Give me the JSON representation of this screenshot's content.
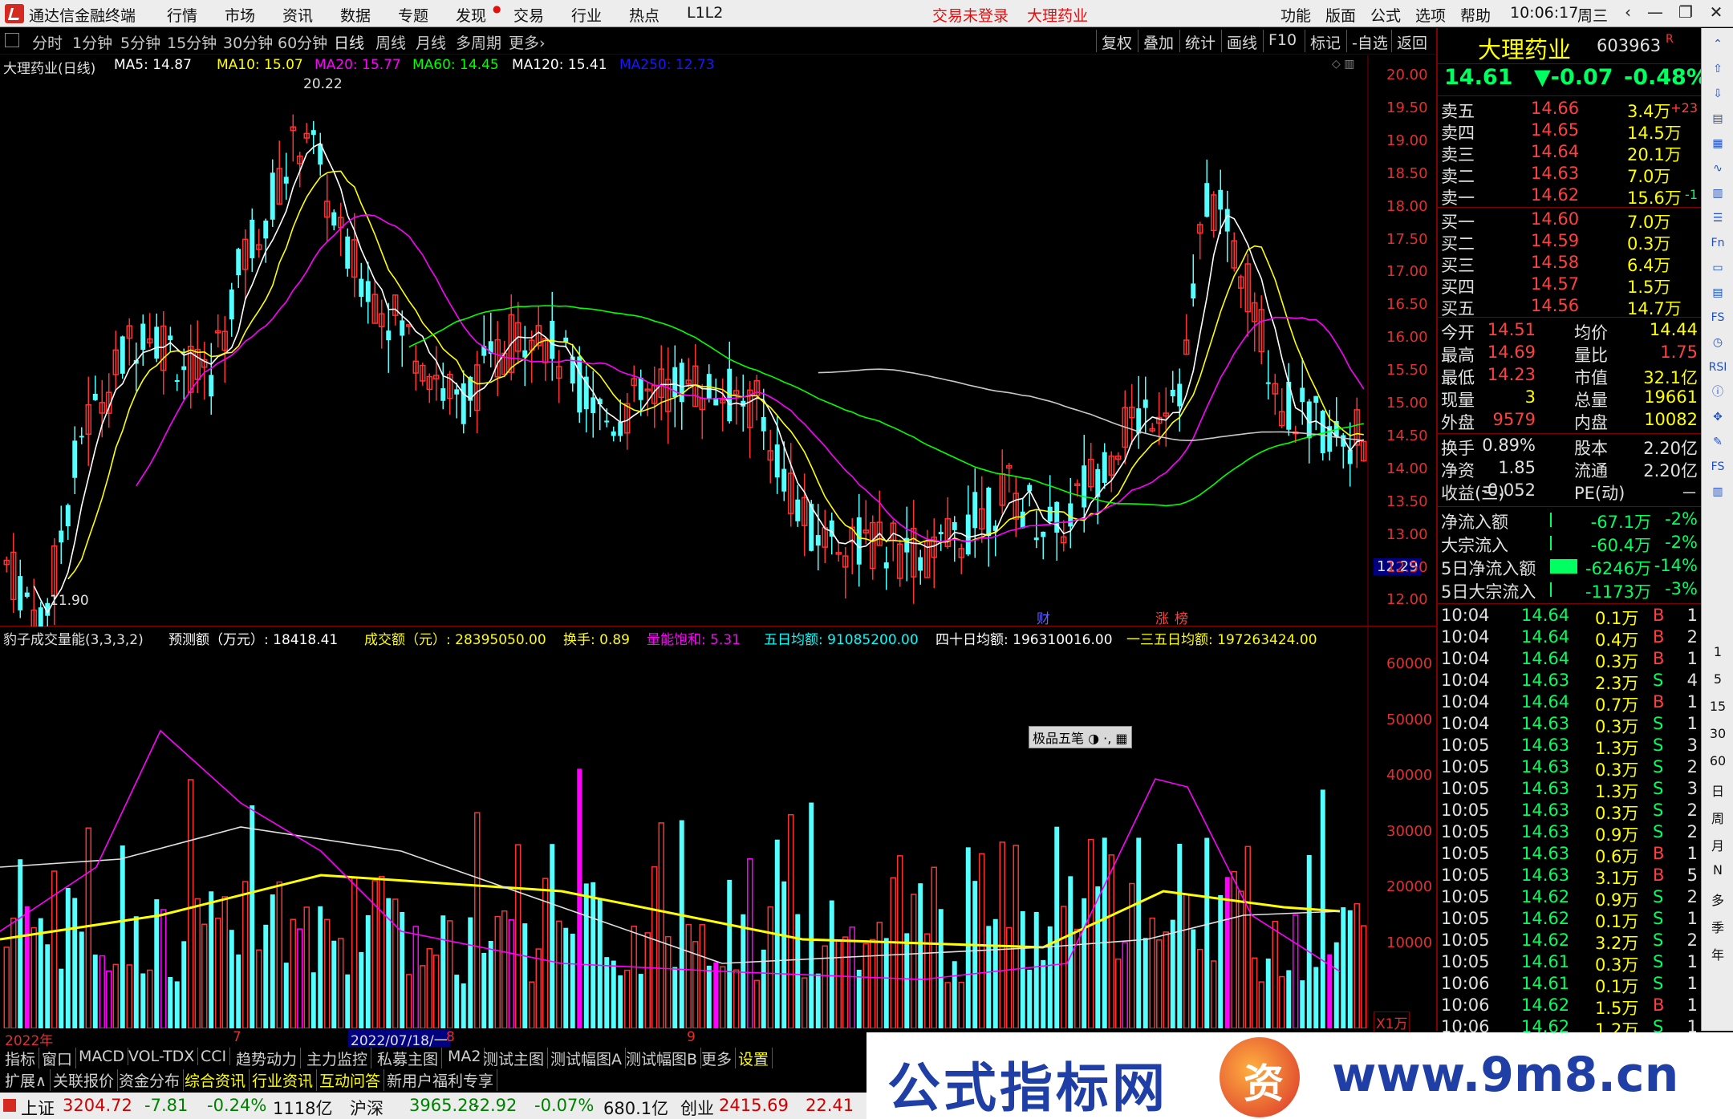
{
  "menubar": {
    "app_title": "通达信金融终端",
    "items": [
      "行情",
      "市场",
      "资讯",
      "数据",
      "专题",
      "发现",
      "交易",
      "行业",
      "热点",
      "L1L2"
    ],
    "login_status": "交易未登录",
    "stock_name": "大理药业",
    "right_items": [
      "功能",
      "版面",
      "公式",
      "选项",
      "帮助"
    ],
    "time": "10:06:17",
    "weekday": "周三",
    "window_buttons": [
      "‹",
      "—",
      "❐",
      "✕"
    ]
  },
  "toolbar": {
    "period_tabs": [
      "分时",
      "1分钟",
      "5分钟",
      "15分钟",
      "30分钟",
      "60分钟",
      "日线",
      "周线",
      "月线",
      "多周期",
      "更多›"
    ],
    "active_tab": "日线",
    "right_buttons": [
      "复权",
      "叠加",
      "统计",
      "画线",
      "F10",
      "标记",
      "-自选",
      "返回"
    ]
  },
  "main_chart": {
    "title": "大理药业(日线)",
    "ma_labels": [
      {
        "text": "MA5: 14.87",
        "color": "#ffffff"
      },
      {
        "text": "MA10: 15.07",
        "color": "#ffff00"
      },
      {
        "text": "MA20: 15.77",
        "color": "#ff00ff"
      },
      {
        "text": "MA60: 14.45",
        "color": "#00ff00"
      },
      {
        "text": "MA120: 15.41",
        "color": "#ffffff"
      },
      {
        "text": "MA250: 12.73",
        "color": "#0000ff"
      }
    ],
    "high_marker": "20.22",
    "low_marker": "11.90",
    "current_price_tag": "12.29",
    "price_axis": [
      "20.00",
      "19.50",
      "19.00",
      "18.50",
      "18.00",
      "17.50",
      "17.00",
      "16.50",
      "16.00",
      "15.50",
      "15.00",
      "14.50",
      "14.00",
      "13.50",
      "13.00",
      "12.50",
      "12.00"
    ],
    "event_markers": [
      "财",
      "涨",
      "榜"
    ]
  },
  "volume_chart": {
    "title": "豹子成交量能(3,3,3,2)",
    "labels": [
      {
        "text": "预测额（万元）: 18418.41",
        "color": "#ffffff"
      },
      {
        "text": "成交额（元）: 28395050.00",
        "color": "#ffff00"
      },
      {
        "text": "换手: 0.89",
        "color": "#ffff00"
      },
      {
        "text": "量能饱和: 5.31",
        "color": "#ff00ff"
      },
      {
        "text": "五日均额: 91085200.00",
        "color": "#00ffff"
      },
      {
        "text": "四十日均额: 196310016.00",
        "color": "#ffffff"
      },
      {
        "text": "一三五日均额: 197263424.00",
        "color": "#ffff00"
      }
    ],
    "axis": [
      "60000",
      "50000",
      "40000",
      "30000",
      "20000",
      "10000"
    ],
    "unit": "X1万",
    "ime_bar": "极品五笔"
  },
  "date_axis": {
    "labels": [
      "2022年",
      "7",
      "2022/07/18/一",
      "8",
      "9"
    ]
  },
  "right_panel": {
    "stock_name": "大理药业",
    "stock_code": "603963",
    "code_flag": "R",
    "price": "14.61",
    "change": "▼-0.07",
    "change_pct": "-0.48%",
    "asks": [
      {
        "label": "卖五",
        "price": "14.66",
        "vol": "3.4万",
        "extra": "+23"
      },
      {
        "label": "卖四",
        "price": "14.65",
        "vol": "14.5万",
        "extra": ""
      },
      {
        "label": "卖三",
        "price": "14.64",
        "vol": "20.1万",
        "extra": ""
      },
      {
        "label": "卖二",
        "price": "14.63",
        "vol": "7.0万",
        "extra": ""
      },
      {
        "label": "卖一",
        "price": "14.62",
        "vol": "15.6万",
        "extra": "-1"
      }
    ],
    "bids": [
      {
        "label": "买一",
        "price": "14.60",
        "vol": "7.0万"
      },
      {
        "label": "买二",
        "price": "14.59",
        "vol": "0.3万"
      },
      {
        "label": "买三",
        "price": "14.58",
        "vol": "6.4万"
      },
      {
        "label": "买四",
        "price": "14.57",
        "vol": "1.5万"
      },
      {
        "label": "买五",
        "price": "14.56",
        "vol": "14.7万"
      }
    ],
    "stats": [
      {
        "l1": "今开",
        "v1": "14.51",
        "l2": "均价",
        "v2": "14.44"
      },
      {
        "l1": "最高",
        "v1": "14.69",
        "l2": "量比",
        "v2": "1.75"
      },
      {
        "l1": "最低",
        "v1": "14.23",
        "l2": "市值",
        "v2": "32.1亿"
      },
      {
        "l1": "现量",
        "v1": "3",
        "l2": "总量",
        "v2": "19661"
      },
      {
        "l1": "外盘",
        "v1": "9579",
        "l2": "内盘",
        "v2": "10082"
      }
    ],
    "stats2": [
      {
        "l1": "换手",
        "v1": "0.89%",
        "l2": "股本",
        "v2": "2.20亿"
      },
      {
        "l1": "净资",
        "v1": "1.85",
        "l2": "流通",
        "v2": "2.20亿"
      },
      {
        "l1": "收益(三)",
        "v1": "-0.052",
        "l2": "PE(动)",
        "v2": "－"
      }
    ],
    "flows": [
      {
        "label": "净流入额",
        "value": "-67.1万",
        "pct": "-2%"
      },
      {
        "label": "大宗流入",
        "value": "-60.4万",
        "pct": "-2%"
      },
      {
        "label": "5日净流入额",
        "value": "-6246万",
        "pct": "-14%"
      },
      {
        "label": "5日大宗流入",
        "value": "-1173万",
        "pct": "-3%"
      }
    ],
    "ticks": [
      {
        "t": "10:04",
        "p": "14.64",
        "v": "0.1万",
        "s": "B",
        "n": "1"
      },
      {
        "t": "10:04",
        "p": "14.64",
        "v": "0.4万",
        "s": "B",
        "n": "2"
      },
      {
        "t": "10:04",
        "p": "14.64",
        "v": "0.3万",
        "s": "B",
        "n": "1"
      },
      {
        "t": "10:04",
        "p": "14.63",
        "v": "2.3万",
        "s": "S",
        "n": "4"
      },
      {
        "t": "10:04",
        "p": "14.64",
        "v": "0.7万",
        "s": "B",
        "n": "1"
      },
      {
        "t": "10:04",
        "p": "14.63",
        "v": "0.3万",
        "s": "S",
        "n": "1"
      },
      {
        "t": "10:05",
        "p": "14.63",
        "v": "1.3万",
        "s": "S",
        "n": "3"
      },
      {
        "t": "10:05",
        "p": "14.63",
        "v": "0.3万",
        "s": "S",
        "n": "2"
      },
      {
        "t": "10:05",
        "p": "14.63",
        "v": "1.3万",
        "s": "S",
        "n": "3"
      },
      {
        "t": "10:05",
        "p": "14.63",
        "v": "0.3万",
        "s": "S",
        "n": "2"
      },
      {
        "t": "10:05",
        "p": "14.63",
        "v": "0.9万",
        "s": "S",
        "n": "2"
      },
      {
        "t": "10:05",
        "p": "14.63",
        "v": "0.6万",
        "s": "B",
        "n": "1"
      },
      {
        "t": "10:05",
        "p": "14.63",
        "v": "3.1万",
        "s": "B",
        "n": "5"
      },
      {
        "t": "10:05",
        "p": "14.62",
        "v": "0.9万",
        "s": "S",
        "n": "2"
      },
      {
        "t": "10:05",
        "p": "14.62",
        "v": "0.1万",
        "s": "S",
        "n": "1"
      },
      {
        "t": "10:05",
        "p": "14.62",
        "v": "3.2万",
        "s": "S",
        "n": "2"
      },
      {
        "t": "10:05",
        "p": "14.61",
        "v": "0.3万",
        "s": "S",
        "n": "1"
      },
      {
        "t": "10:06",
        "p": "14.61",
        "v": "0.1万",
        "s": "S",
        "n": "1"
      },
      {
        "t": "10:06",
        "p": "14.62",
        "v": "1.5万",
        "s": "B",
        "n": "1"
      },
      {
        "t": "10:06",
        "p": "14.62",
        "v": "1.2万",
        "s": "S",
        "n": "1"
      }
    ]
  },
  "sidebar": {
    "icons": [
      "up-arrow-icon",
      "up-arrow-icon",
      "down-arrow-icon",
      "chart-icon",
      "grid-icon",
      "line-chart-icon",
      "bar-icon",
      "list-icon",
      "f10-icon",
      "doc-icon",
      "table-icon",
      "fs-icon",
      "clock-icon",
      "rsi-icon",
      "info-icon",
      "move-icon",
      "pen-icon",
      "fs2-icon",
      "book-icon"
    ],
    "periods": [
      "1",
      "5",
      "15",
      "30",
      "60",
      "日",
      "周",
      "月",
      "N",
      "多",
      "季",
      "年"
    ]
  },
  "bottom_tabs_1": [
    "指标",
    "窗口",
    "MACD",
    "VOL-TDX",
    "CCI",
    "趋势动力",
    "主力监控",
    "私募主图",
    "MA2",
    "测试主图",
    "测试幅图A",
    "测试幅图B",
    "更多",
    "设置"
  ],
  "bottom_tabs_2": [
    "扩展∧",
    "关联报价",
    "资金分布",
    "综合资讯",
    "行业资讯",
    "互动问答",
    "新用户福利专享"
  ],
  "statusbar": {
    "items": [
      {
        "name": "上证",
        "value": "3204.72",
        "chg": "-7.81",
        "pct": "-0.24%",
        "amt": "1118亿"
      },
      {
        "name": "沪深",
        "value": "3965.28",
        "chg": "-2.92",
        "pct": "-0.07%",
        "amt": "680.1亿"
      },
      {
        "name": "创业",
        "value": "2415.69",
        "chg": "22.41",
        "pct": "",
        "amt": ""
      }
    ]
  },
  "banner": {
    "left_text": "公式指标网",
    "badge": "资",
    "right_text": "www.9m8.cn"
  },
  "colors": {
    "up": "#ff3232",
    "down": "#54ffff",
    "ma5": "#ffffff",
    "ma10": "#ffff00",
    "ma20": "#ff00ff",
    "ma60": "#00ff00",
    "ma120": "#c8c8c8",
    "ma250": "#1010ff"
  }
}
